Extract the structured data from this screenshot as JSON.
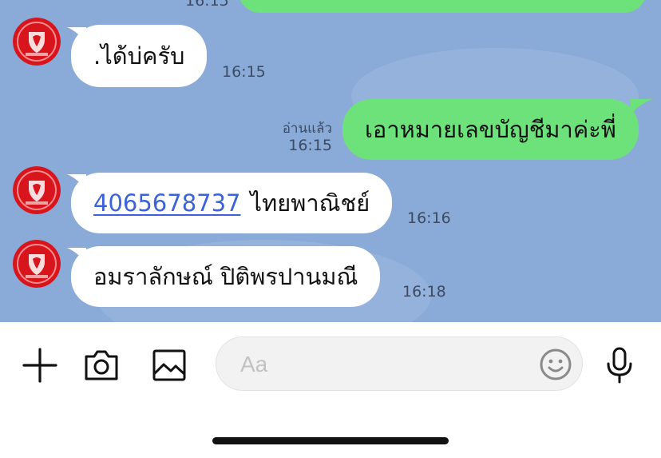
{
  "messages": [
    {
      "text": ".ได้บ่ครับ",
      "time": "16:15"
    },
    {
      "read_label": "อ่านแล้ว",
      "text": "เอาหมายเลขบัญชีมาค่ะพี่",
      "time": "16:15"
    },
    {
      "account": "4065678737",
      "bank": "ไทยพาณิชย์",
      "time": "16:16"
    },
    {
      "text": "อมราลักษณ์ ปิติพรปานมณี",
      "time": "16:18"
    }
  ],
  "previous_time_partial": "16:15",
  "composer": {
    "placeholder": "Aa"
  },
  "colors": {
    "chat_background": "#8aaad8",
    "outgoing_bubble": "#6ee27a",
    "incoming_bubble": "#ffffff",
    "link": "#3c62d9"
  },
  "icons": [
    "plus-icon",
    "camera-icon",
    "image-icon",
    "emoji-icon",
    "microphone-icon"
  ]
}
